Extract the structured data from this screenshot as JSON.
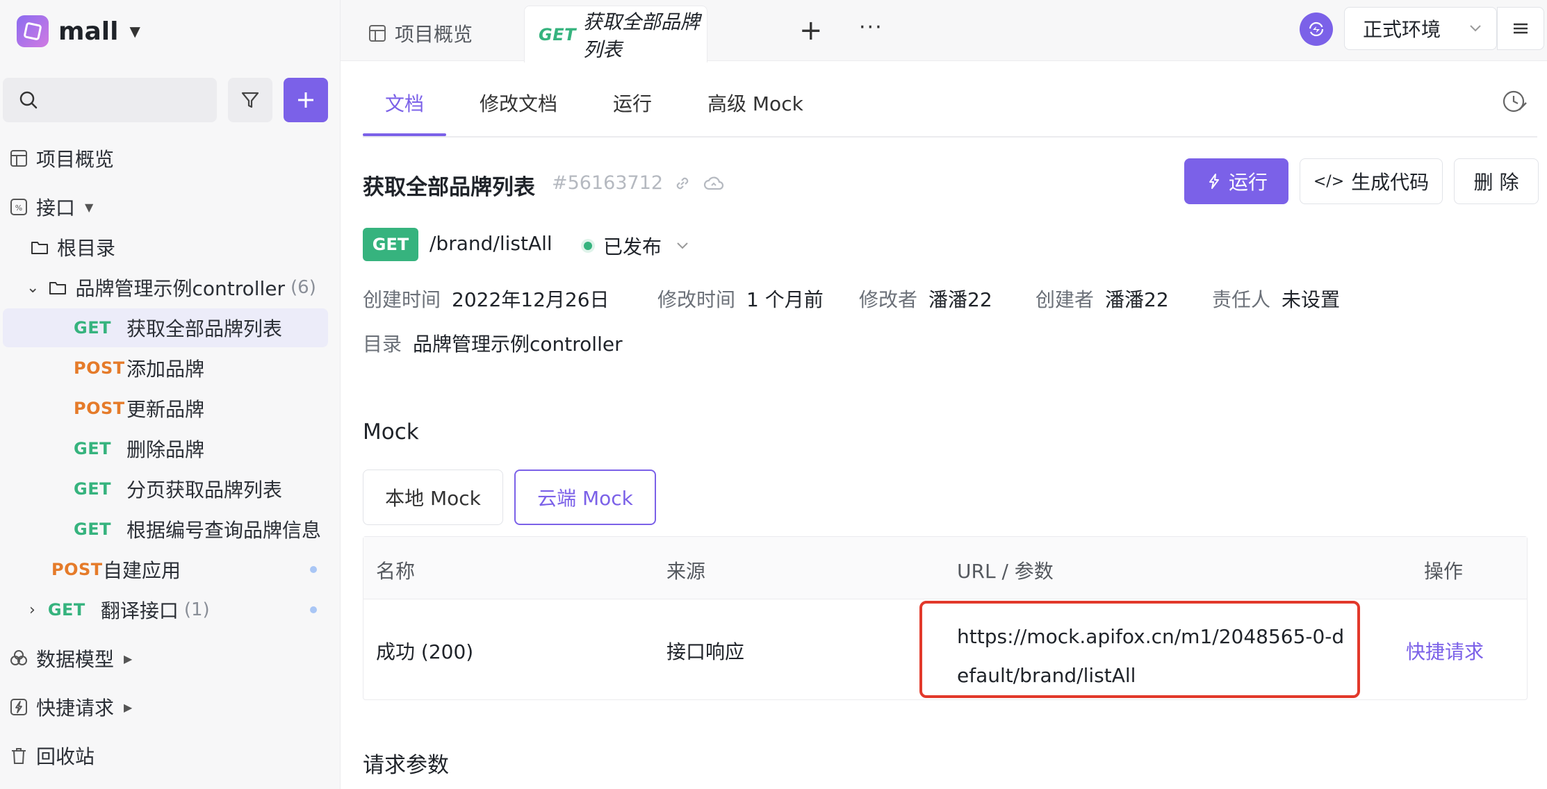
{
  "sidebar": {
    "project_name": "mall",
    "nav": {
      "overview": "项目概览",
      "interfaces": "接口",
      "root": "根目录",
      "folder": "品牌管理示例controller",
      "folder_count": "(6)",
      "data_model": "数据模型",
      "quick_request": "快捷请求",
      "recycle": "回收站"
    },
    "items": [
      {
        "method": "GET",
        "label": "获取全部品牌列表"
      },
      {
        "method": "POST",
        "label": "添加品牌"
      },
      {
        "method": "POST",
        "label": "更新品牌"
      },
      {
        "method": "GET",
        "label": "删除品牌"
      },
      {
        "method": "GET",
        "label": "分页获取品牌列表"
      },
      {
        "method": "GET",
        "label": "根据编号查询品牌信息"
      }
    ],
    "extra": [
      {
        "method": "POST",
        "label": "自建应用"
      },
      {
        "method": "GET",
        "label": "翻译接口",
        "count": "(1)"
      }
    ]
  },
  "topbar": {
    "tab_overview": "项目概览",
    "tab_active_method": "GET",
    "tab_active_label": "获取全部品牌列表",
    "plus": "+",
    "more": "···",
    "env": "正式环境"
  },
  "subtabs": [
    "文档",
    "修改文档",
    "运行",
    "高级 Mock"
  ],
  "api": {
    "title": "获取全部品牌列表",
    "id": "#56163712",
    "method": "GET",
    "path": "/brand/listAll",
    "status": "已发布",
    "buttons": {
      "run": "运行",
      "code": "生成代码",
      "delete": "删 除"
    },
    "meta": [
      {
        "k": "创建时间",
        "v": "2022年12月26日"
      },
      {
        "k": "修改时间",
        "v": "1 个月前"
      },
      {
        "k": "修改者",
        "v": "潘潘22"
      },
      {
        "k": "创建者",
        "v": "潘潘22"
      },
      {
        "k": "责任人",
        "v": "未设置"
      }
    ],
    "dir_k": "目录",
    "dir_v": "品牌管理示例controller"
  },
  "mock": {
    "heading": "Mock",
    "local": "本地 Mock",
    "cloud": "云端 Mock",
    "headers": [
      "名称",
      "来源",
      "URL / 参数",
      "操作"
    ],
    "row": {
      "name": "成功 (200)",
      "source": "接口响应",
      "url": "https://mock.apifox.cn/m1/2048565-0-default/brand/listAll",
      "action": "快捷请求"
    }
  },
  "params_heading": "请求参数",
  "colors": {
    "accent": "#7b61e8",
    "get": "#36b37e",
    "post": "#e57b2a",
    "highlight": "#e2392b"
  }
}
